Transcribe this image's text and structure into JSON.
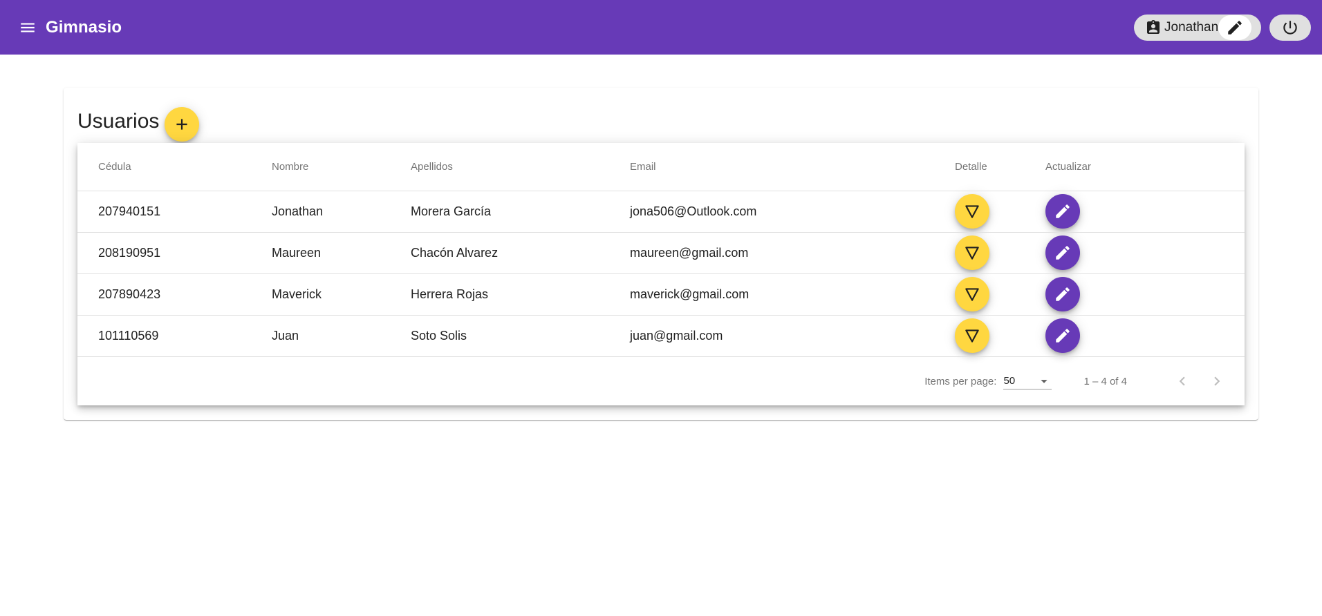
{
  "app": {
    "title": "Gimnasio"
  },
  "user": {
    "name": "Jonathan"
  },
  "page": {
    "title": "Usuarios"
  },
  "table": {
    "headers": [
      "Cédula",
      "Nombre",
      "Apellidos",
      "Email",
      "Detalle",
      "Actualizar"
    ],
    "rows": [
      {
        "cedula": "207940151",
        "nombre": "Jonathan",
        "apellidos": "Morera García",
        "email": "jona506@Outlook.com"
      },
      {
        "cedula": "208190951",
        "nombre": "Maureen",
        "apellidos": "Chacón Alvarez",
        "email": "maureen@gmail.com"
      },
      {
        "cedula": "207890423",
        "nombre": "Maverick",
        "apellidos": "Herrera Rojas",
        "email": "maverick@gmail.com"
      },
      {
        "cedula": "101110569",
        "nombre": "Juan",
        "apellidos": "Soto Solis",
        "email": "juan@gmail.com"
      }
    ]
  },
  "paginator": {
    "items_per_page_label": "Items per page:",
    "items_per_page": "50",
    "range": "1 – 4 of 4"
  },
  "colors": {
    "primary": "#673ab7",
    "accent": "#ffd740"
  },
  "icons": {
    "menu": "menu-icon",
    "badge": "badge-icon",
    "edit": "pencil-icon",
    "logout": "power-icon",
    "add": "plus-icon",
    "detail": "triangle-down-icon",
    "prev": "chevron-left-icon",
    "next": "chevron-right-icon",
    "dropdown": "caret-down-icon"
  }
}
